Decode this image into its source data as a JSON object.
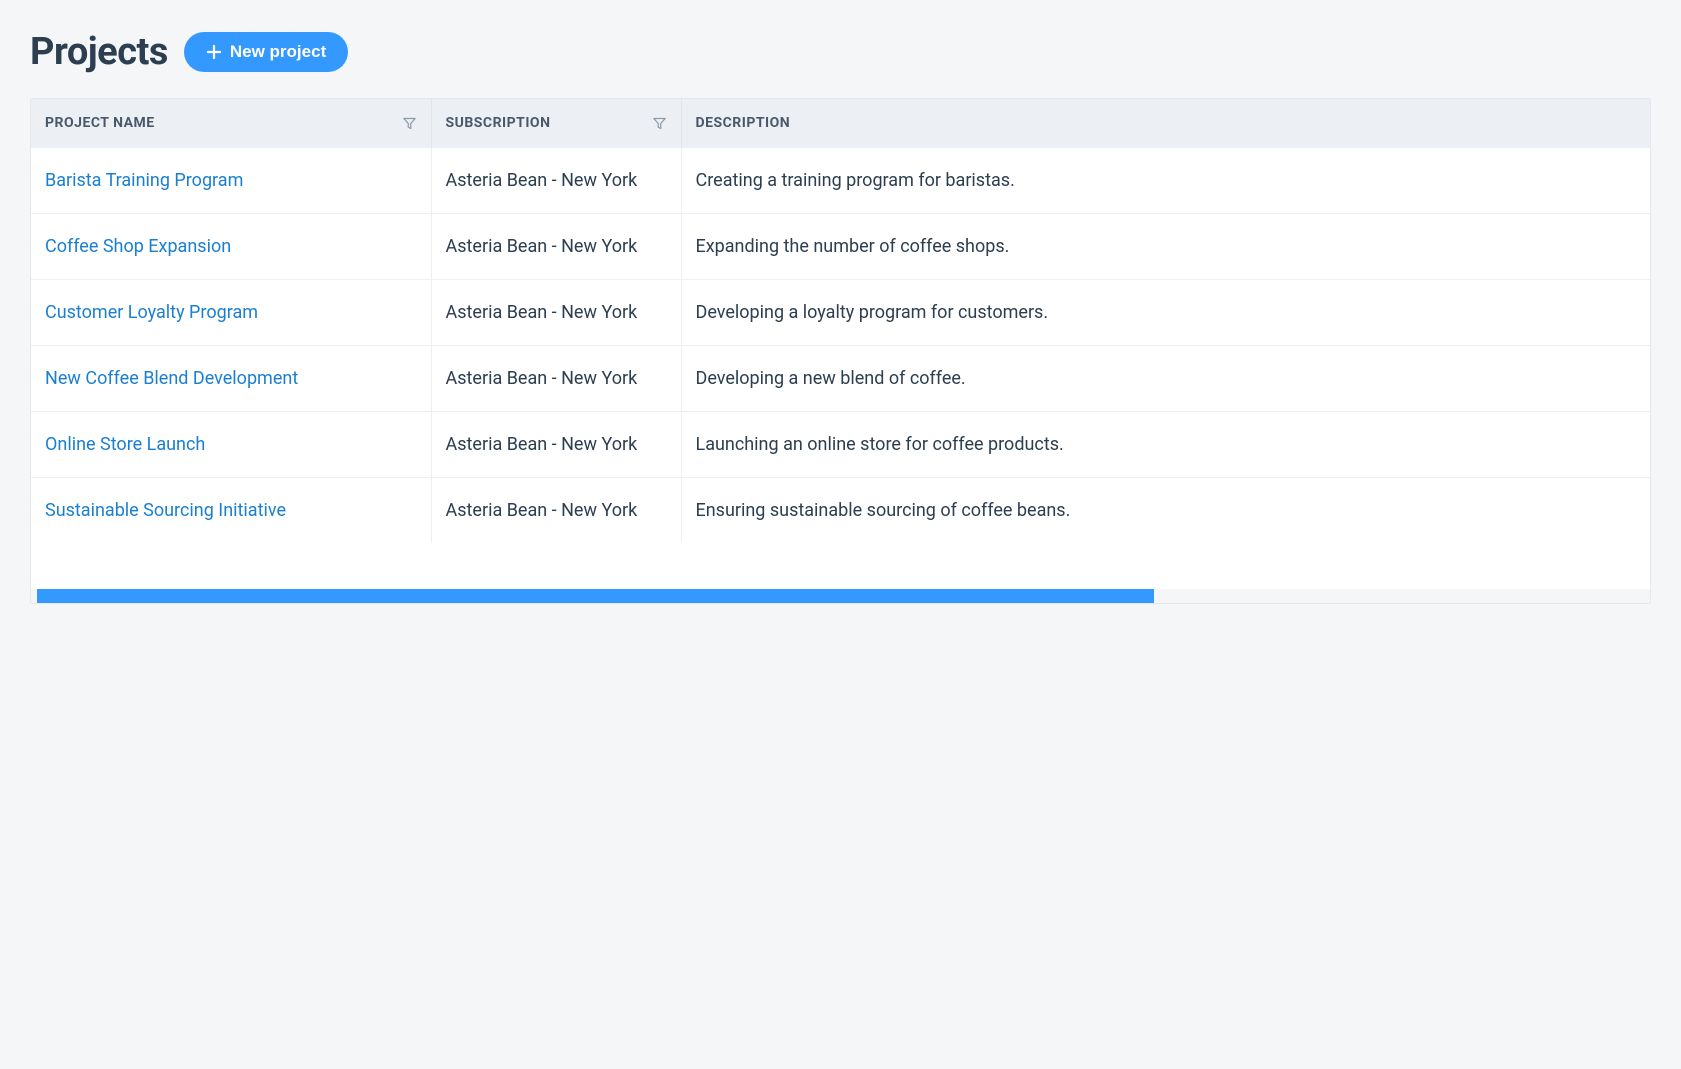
{
  "header": {
    "title": "Projects",
    "new_project_label": "New project"
  },
  "table": {
    "columns": {
      "name": "PROJECT NAME",
      "subscription": "SUBSCRIPTION",
      "description": "DESCRIPTION"
    },
    "rows": [
      {
        "name": "Barista Training Program",
        "subscription": "Asteria Bean - New York",
        "description": "Creating a training program for baristas."
      },
      {
        "name": "Coffee Shop Expansion",
        "subscription": "Asteria Bean - New York",
        "description": "Expanding the number of coffee shops."
      },
      {
        "name": "Customer Loyalty Program",
        "subscription": "Asteria Bean - New York",
        "description": "Developing a loyalty program for customers."
      },
      {
        "name": "New Coffee Blend Development",
        "subscription": "Asteria Bean - New York",
        "description": "Developing a new blend of coffee."
      },
      {
        "name": "Online Store Launch",
        "subscription": "Asteria Bean - New York",
        "description": "Launching an online store for coffee products."
      },
      {
        "name": "Sustainable Sourcing Initiative",
        "subscription": "Asteria Bean - New York",
        "description": "Ensuring sustainable sourcing of coffee beans."
      }
    ]
  }
}
